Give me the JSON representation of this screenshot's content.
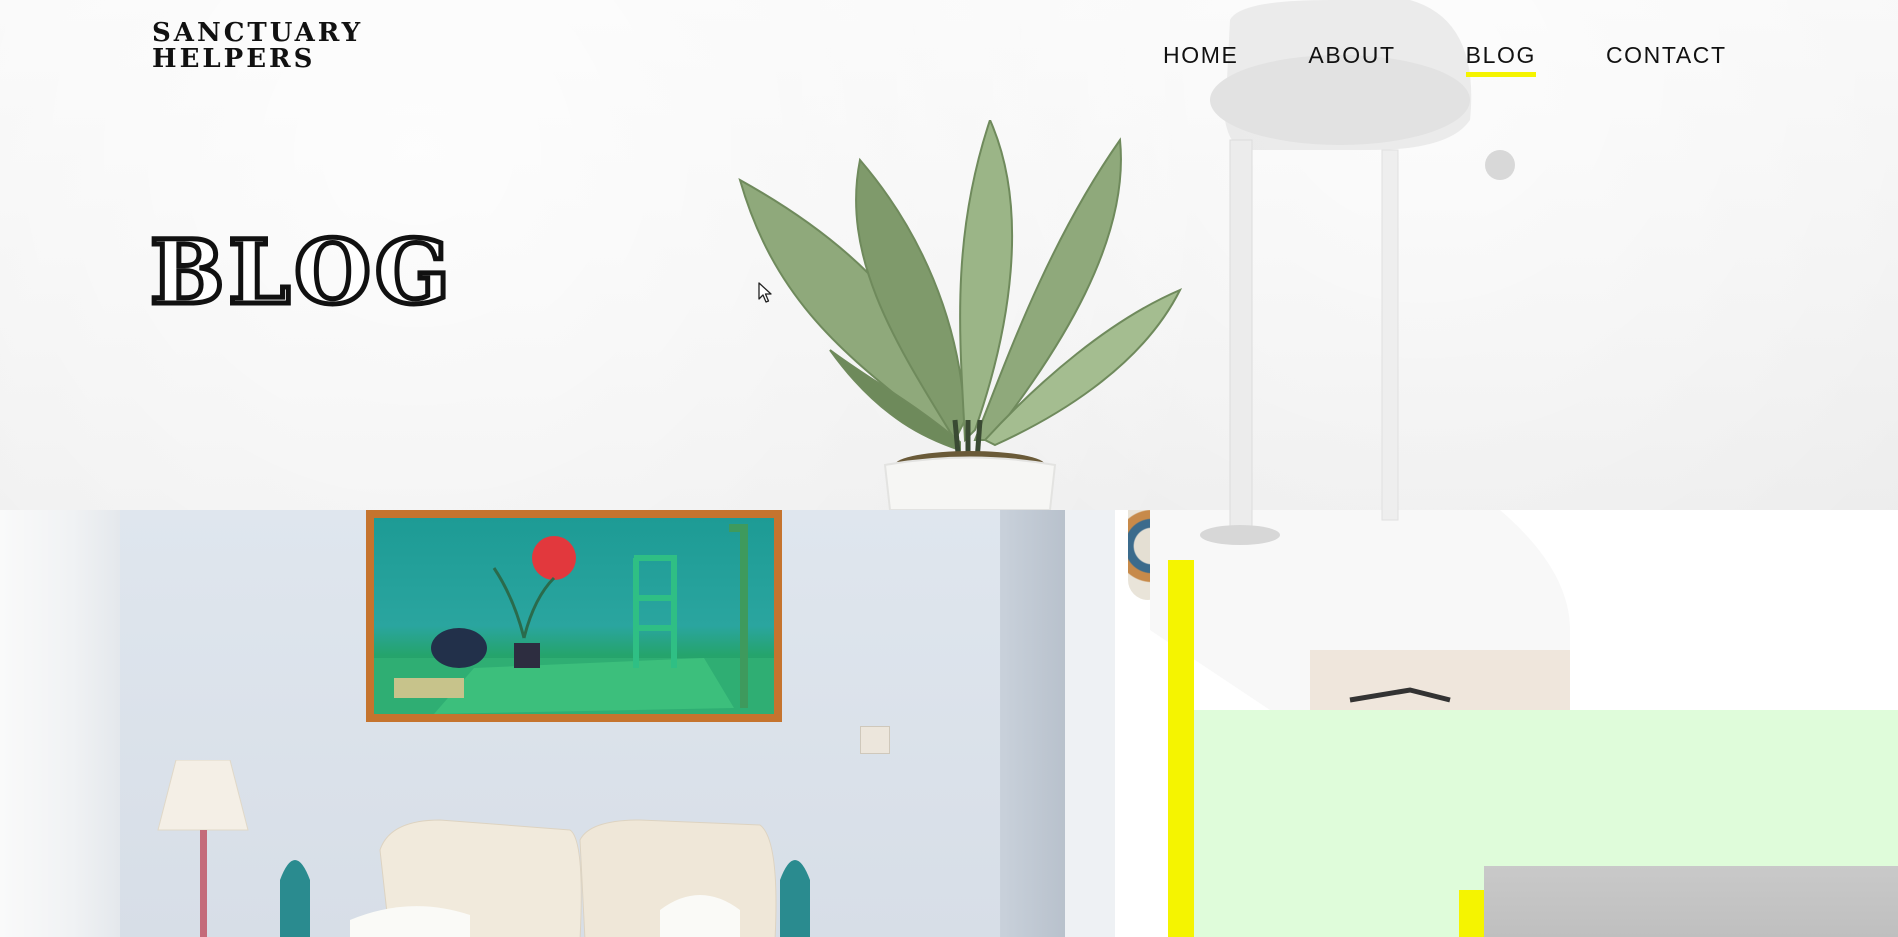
{
  "site": {
    "logo_line1": "SANCTUARY",
    "logo_line2": "HELPERS"
  },
  "nav": {
    "items": [
      {
        "label": "HOME",
        "active": false
      },
      {
        "label": "ABOUT",
        "active": false
      },
      {
        "label": "BLOG",
        "active": true
      },
      {
        "label": "CONTACT",
        "active": false
      }
    ]
  },
  "page": {
    "title": "BLOG"
  },
  "theme": {
    "accent": "#f5f400",
    "text": "#111111",
    "mint": "#dffcda"
  },
  "icons": {
    "cursor": "arrow-pointer-icon"
  }
}
